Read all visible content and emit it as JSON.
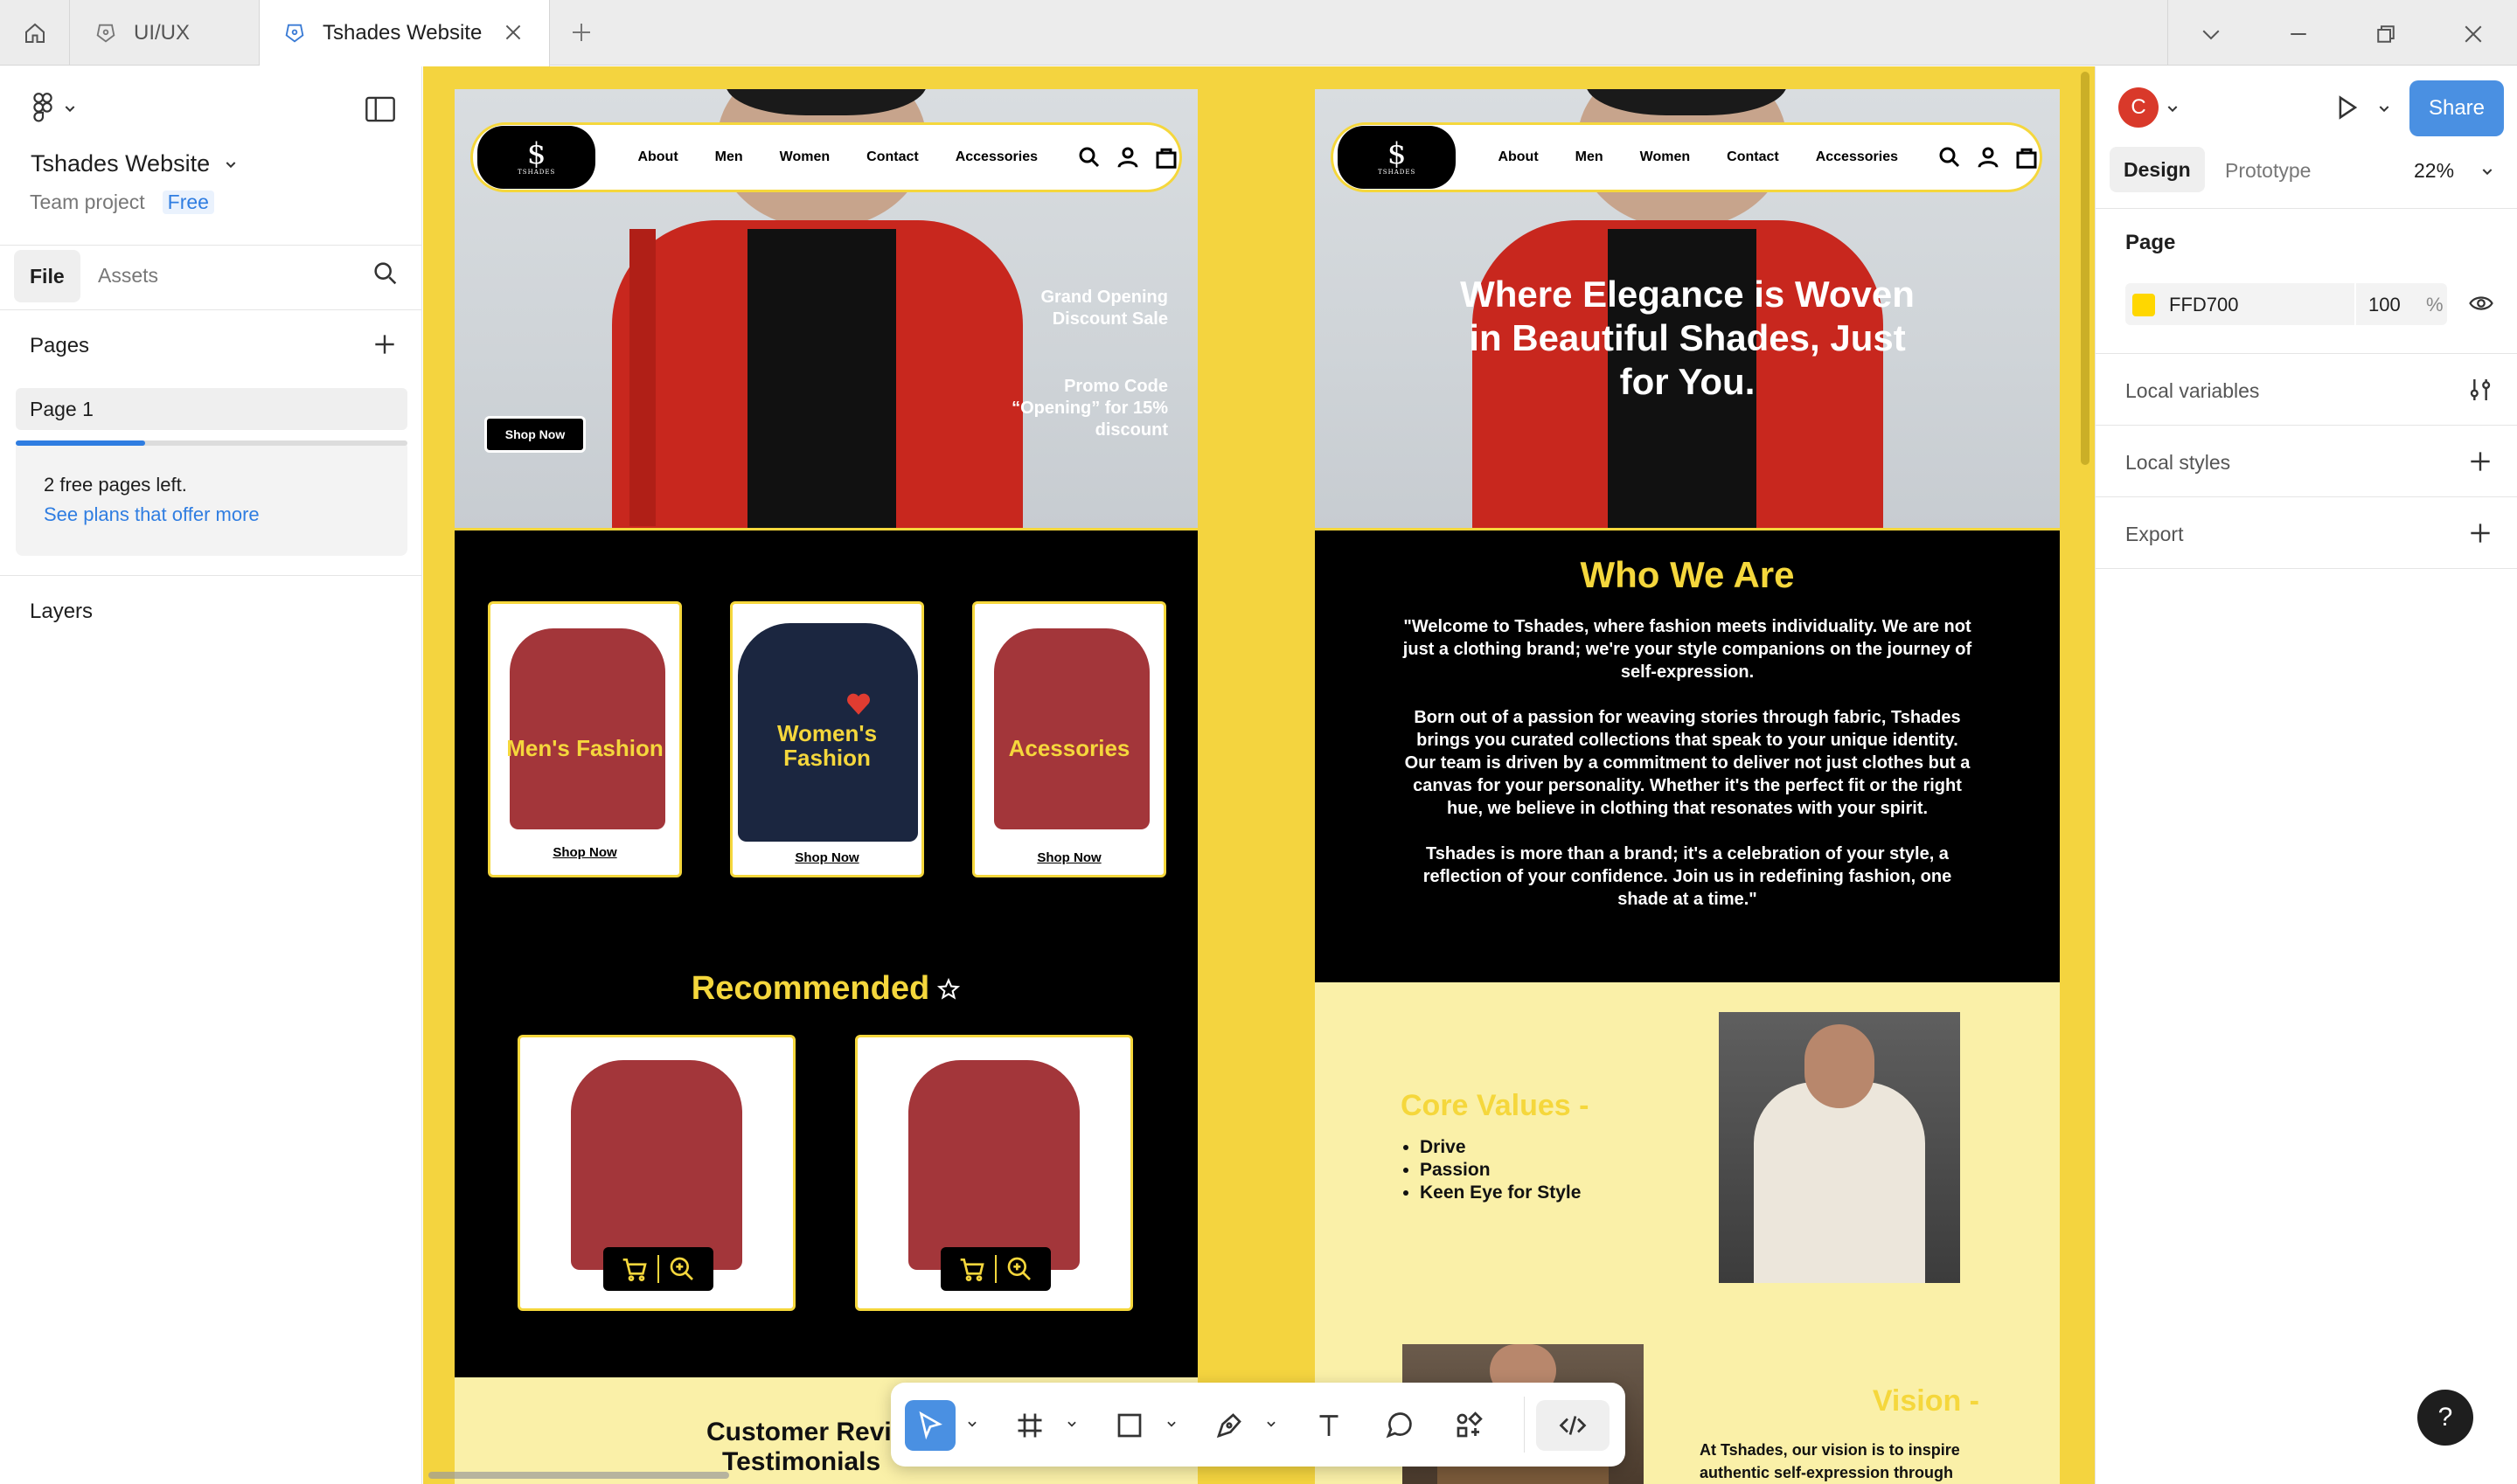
{
  "tabs": {
    "home_icon": "home-icon",
    "items": [
      {
        "label": "UI/UX",
        "active": false
      },
      {
        "label": "Tshades Website",
        "active": true
      }
    ]
  },
  "left_panel": {
    "file_name": "Tshades Website",
    "project": "Team project",
    "plan_badge": "Free",
    "tab_file": "File",
    "tab_assets": "Assets",
    "pages_label": "Pages",
    "page_1": "Page 1",
    "free_pages_msg": "2 free pages left.",
    "plans_link": "See plans that offer more",
    "free_pages_progress": 0.33,
    "layers_label": "Layers"
  },
  "right_panel": {
    "avatar_letter": "C",
    "share_label": "Share",
    "tab_design": "Design",
    "tab_prototype": "Prototype",
    "zoom": "22%",
    "page_section": "Page",
    "page_color_hex": "FFD700",
    "page_opacity": "100",
    "percent_sign": "%",
    "local_variables": "Local variables",
    "local_styles": "Local styles",
    "export": "Export",
    "help": "?"
  },
  "site": {
    "nav": [
      "About",
      "Men",
      "Women",
      "Contact",
      "Accessories"
    ],
    "logo_text": "TSHADES",
    "frame1": {
      "hero_sale": "Grand Opening Discount Sale",
      "hero_promo": "Promo Code “Opening” for 15% discount",
      "hero_button": "Shop Now",
      "categories": [
        {
          "label": "Men's Fashion",
          "link": "Shop Now"
        },
        {
          "label": "Women's Fashion",
          "link": "Shop Now"
        },
        {
          "label": "Acessories",
          "link": "Shop Now"
        }
      ],
      "recommended": "Recommended",
      "reviews_title_1": "Customer Revi",
      "reviews_title_2": "Testimonials"
    },
    "frame2": {
      "hero_title": "Where Elegance is Woven in Beautiful Shades, Just for You.",
      "who_title": "Who We Are",
      "who_p1": "\"Welcome to Tshades, where fashion meets individuality. We are not just a clothing brand; we're your style companions on the journey of self-expression.",
      "who_p2": "Born out of a passion for weaving stories through fabric, Tshades brings you curated collections that speak to your unique identity. Our team is driven by a commitment to deliver not just clothes but a canvas for your personality. Whether it's the perfect fit or the right hue, we believe in clothing that resonates with your spirit.",
      "who_p3": "Tshades is more than a brand; it's a celebration of your style, a reflection of your confidence. Join us in redefining fashion, one shade at a time.\"",
      "core_title": "Core Values -",
      "core_values": [
        "Drive",
        "Passion",
        "Keen Eye for Style"
      ],
      "vision_title": "Vision -",
      "vision_text_1": "At Tshades, our vision is to inspire",
      "vision_text_2": "authentic self-expression through"
    }
  },
  "colors": {
    "brand_yellow": "#F5D73C",
    "canvas_yellow": "#F4D43F",
    "figma_blue": "#4A90E2",
    "sweater_red": "#A3363A",
    "navy": "#1B2640"
  }
}
